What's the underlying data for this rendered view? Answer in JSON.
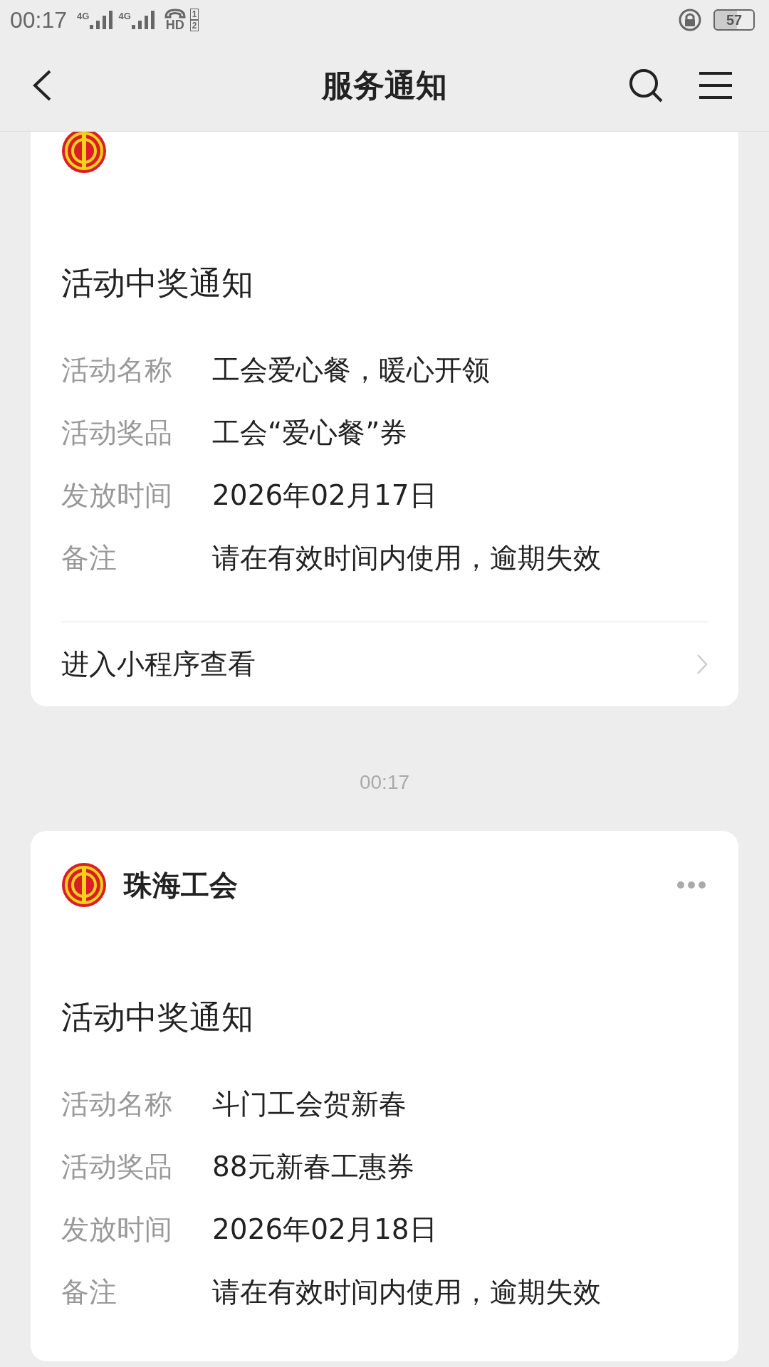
{
  "status_bar": {
    "time": "00:17",
    "signals": [
      "4G",
      "4G"
    ],
    "hd": "HD",
    "sims": [
      "1",
      "2"
    ],
    "battery": "57"
  },
  "nav": {
    "title": "服务通知"
  },
  "feed": [
    {
      "kind": "card",
      "title": "活动中奖通知",
      "fields": [
        {
          "label": "活动名称",
          "value": "工会爱心餐，暖心开领"
        },
        {
          "label": "活动奖品",
          "value": "工会“爱心餐”券"
        },
        {
          "label": "发放时间",
          "value": "2026年02月17日"
        },
        {
          "label": "备注",
          "value": "请在有效时间内使用，逾期失效"
        }
      ],
      "link": "进入小程序查看"
    },
    {
      "kind": "time",
      "text": "00:17"
    },
    {
      "kind": "card",
      "sender": "珠海工会",
      "title": "活动中奖通知",
      "fields": [
        {
          "label": "活动名称",
          "value": "斗门工会贺新春"
        },
        {
          "label": "活动奖品",
          "value": "88元新春工惠券"
        },
        {
          "label": "发放时间",
          "value": "2026年02月18日"
        },
        {
          "label": "备注",
          "value": "请在有效时间内使用，逾期失效"
        }
      ]
    }
  ]
}
